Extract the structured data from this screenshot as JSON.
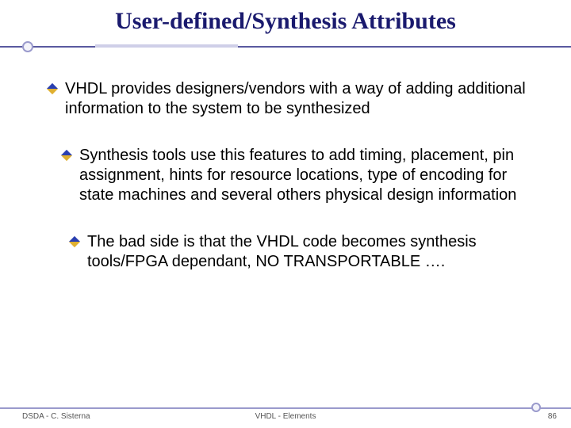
{
  "title": "User-defined/Synthesis Attributes",
  "bullets": [
    "VHDL provides designers/vendors with a way of adding additional information to the system to be synthesized",
    "Synthesis tools use this features to add timing, placement, pin assignment, hints for resource locations, type of encoding for state machines and several others physical design information",
    "The bad side is that the VHDL code becomes synthesis tools/FPGA dependant, NO TRANSPORTABLE …."
  ],
  "footer": {
    "left": "DSDA - C. Sisterna",
    "center": "VHDL - Elements",
    "page": "86"
  },
  "colors": {
    "title": "#1a1a6e",
    "rule": "#9a9acc"
  }
}
